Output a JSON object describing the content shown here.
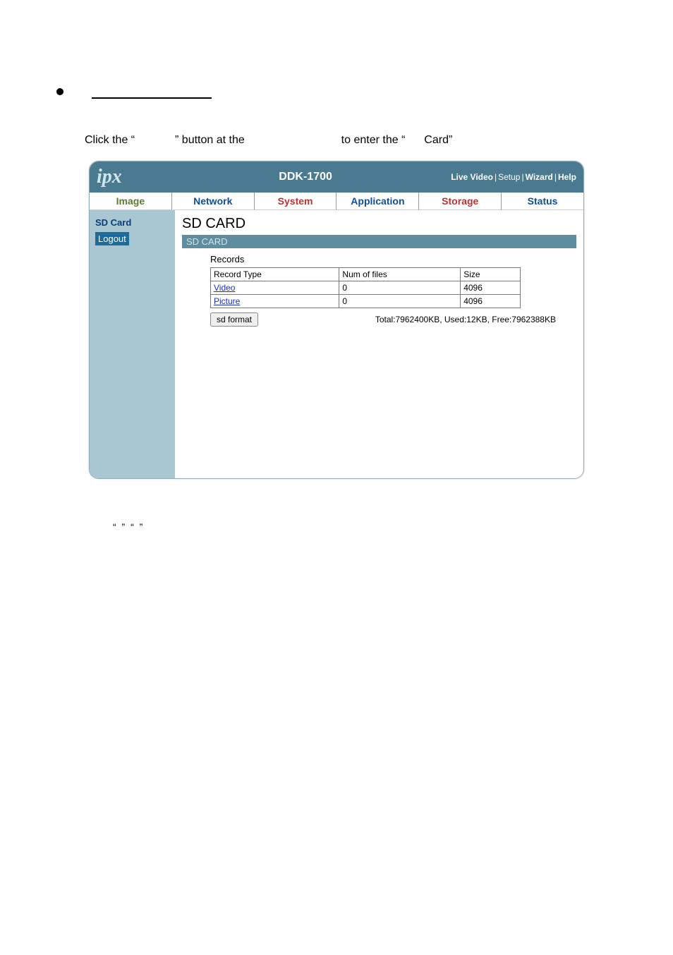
{
  "instruction": {
    "part1": "Click the “",
    "part2": "” button at the",
    "part3": "to enter the “",
    "part4": "Card”"
  },
  "header": {
    "logo": "ipx",
    "model": "DDK-1700",
    "links": {
      "live_video": "Live Video",
      "setup": "Setup",
      "wizard": "Wizard",
      "help": "Help"
    }
  },
  "tabs": {
    "image": "Image",
    "network": "Network",
    "system": "System",
    "application": "Application",
    "storage": "Storage",
    "status": "Status"
  },
  "sidebar": {
    "sdcard": "SD Card",
    "logout": "Logout"
  },
  "main": {
    "title": "SD CARD",
    "subtitle": "SD CARD",
    "records_label": "Records",
    "table": {
      "headers": {
        "type": "Record Type",
        "num": "Num of files",
        "size": "Size"
      },
      "rows": [
        {
          "type": "Video",
          "num": "0",
          "size": "4096"
        },
        {
          "type": "Picture",
          "num": "0",
          "size": "4096"
        }
      ]
    },
    "format_btn": "sd format",
    "usage": "Total:7962400KB, Used:12KB, Free:7962388KB"
  },
  "quotes": "“        ”     “          ”"
}
